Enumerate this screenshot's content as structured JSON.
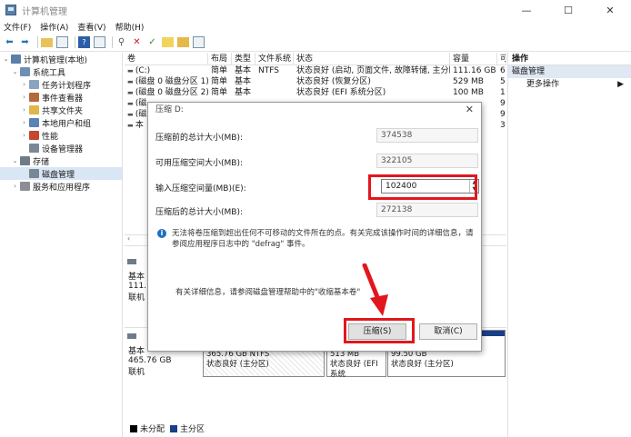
{
  "window": {
    "title": "计算机管理",
    "minimize": "—",
    "maximize": "☐",
    "close": "✕"
  },
  "menu": [
    "文件(F)",
    "操作(A)",
    "查看(V)",
    "帮助(H)"
  ],
  "tree": [
    {
      "label": "计算机管理(本地)",
      "indent": 0,
      "chev": "⌄",
      "icon_color": "#5b7fa8"
    },
    {
      "label": "系统工具",
      "indent": 1,
      "chev": "⌄",
      "icon_color": "#6c8fb5"
    },
    {
      "label": "任务计划程序",
      "indent": 2,
      "chev": "›",
      "icon_color": "#8aa3bf"
    },
    {
      "label": "事件查看器",
      "indent": 2,
      "chev": "›",
      "icon_color": "#b36a3b"
    },
    {
      "label": "共享文件夹",
      "indent": 2,
      "chev": "›",
      "icon_color": "#e0b64a"
    },
    {
      "label": "本地用户和组",
      "indent": 2,
      "chev": "›",
      "icon_color": "#5a82b8"
    },
    {
      "label": "性能",
      "indent": 2,
      "chev": "›",
      "icon_color": "#c2482f"
    },
    {
      "label": "设备管理器",
      "indent": 2,
      "chev": "",
      "icon_color": "#7a8896"
    },
    {
      "label": "存储",
      "indent": 1,
      "chev": "⌄",
      "icon_color": "#6f7b87"
    },
    {
      "label": "磁盘管理",
      "indent": 2,
      "chev": "",
      "icon_color": "#7a8896",
      "selected": true
    },
    {
      "label": "服务和应用程序",
      "indent": 1,
      "chev": "›",
      "icon_color": "#8a8f95"
    }
  ],
  "table": {
    "headers": [
      "卷",
      "布局",
      "类型",
      "文件系统",
      "状态",
      "容量",
      "可"
    ],
    "rows": [
      [
        "(C:)",
        "简单",
        "基本",
        "NTFS",
        "状态良好 (启动, 页面文件, 故障转储, 主分区)",
        "111.16 GB",
        "6"
      ],
      [
        "(磁盘 0 磁盘分区 1)",
        "简单",
        "基本",
        "",
        "状态良好 (恢复分区)",
        "529 MB",
        "5"
      ],
      [
        "(磁盘 0 磁盘分区 2)",
        "简单",
        "基本",
        "",
        "状态良好 (EFI 系统分区)",
        "100 MB",
        "1"
      ],
      [
        "(磁",
        "",
        "",
        "",
        "",
        "",
        "9"
      ],
      [
        "(磁",
        "",
        "",
        "",
        "",
        "",
        "9"
      ],
      [
        "本",
        "",
        "",
        "",
        "",
        "",
        "3"
      ]
    ]
  },
  "actions": {
    "header": "操作",
    "section": "磁盘管理",
    "item": "更多操作",
    "arrow": "▶"
  },
  "disks": [
    {
      "l1": "基本",
      "l2": "111.",
      "l3": "联机"
    },
    {
      "l1": "基本",
      "l2": "465.76 GB",
      "l3": "联机"
    }
  ],
  "partitions": [
    {
      "size": "365.76 GB NTFS",
      "status": "状态良好 (主分区)"
    },
    {
      "size": "513 MB",
      "status": "状态良好 (EFI 系统"
    },
    {
      "size": "99.50 GB",
      "status": "状态良好 (主分区)"
    }
  ],
  "legend": {
    "unallocated": "未分配",
    "primary": "主分区"
  },
  "dialog": {
    "title": "压缩 D:",
    "close": "✕",
    "total_before_label": "压缩前的总计大小(MB):",
    "total_before_value": "374538",
    "available_label": "可用压缩空间大小(MB):",
    "available_value": "322105",
    "input_label": "输入压缩空间量(MB)(E):",
    "input_value": "102400",
    "total_after_label": "压缩后的总计大小(MB):",
    "total_after_value": "272138",
    "info_text": "无法将卷压缩到超出任何不可移动的文件所在的点。有关完成该操作时间的详细信息，请参阅应用程序日志中的 \"defrag\" 事件。",
    "more_info": "有关详细信息，请参阅磁盘管理帮助中的\"收缩基本卷\"",
    "shrink_button": "压缩(S)",
    "cancel_button": "取消(C)"
  },
  "colors": {
    "highlight": "#e1171d",
    "primary_partition": "#1a3f8a",
    "unallocated": "#000000",
    "selected_row": "#d9e6f5"
  }
}
